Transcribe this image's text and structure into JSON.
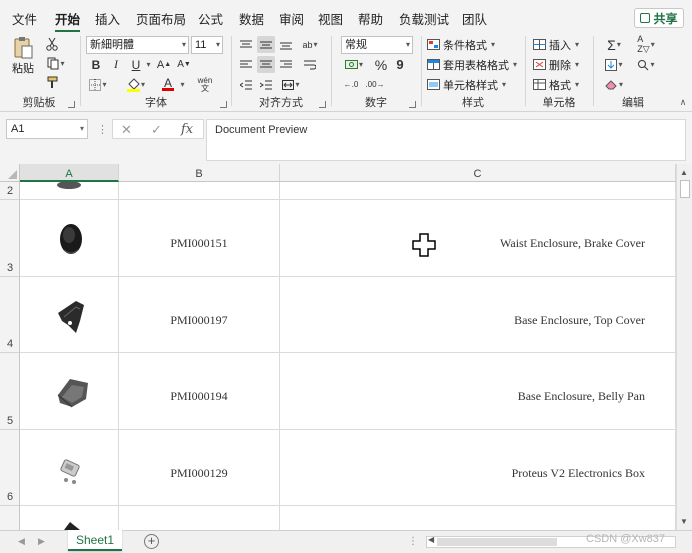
{
  "menu": {
    "tabs": [
      "文件",
      "开始",
      "插入",
      "页面布局",
      "公式",
      "数据",
      "审阅",
      "视图",
      "帮助",
      "负载测试",
      "团队"
    ],
    "active_tab": "开始",
    "share_label": "共享"
  },
  "ribbon": {
    "clipboard": {
      "label": "剪贴板",
      "paste": "粘贴"
    },
    "font": {
      "label": "字体",
      "font_name": "新細明體",
      "font_size": "11",
      "bold": "B",
      "italic": "I",
      "underline": "U",
      "font_color": "A",
      "phonetic": "wén"
    },
    "alignment": {
      "label": "对齐方式"
    },
    "number": {
      "label": "数字",
      "format": "常规",
      "percent": "%",
      "comma": "9"
    },
    "styles": {
      "label": "样式",
      "conditional": "条件格式",
      "table": "套用表格格式",
      "cell_styles": "单元格样式"
    },
    "cells": {
      "label": "单元格",
      "insert": "插入",
      "delete": "删除",
      "format": "格式"
    },
    "editing": {
      "label": "编辑",
      "sum": "Σ"
    }
  },
  "formula_bar": {
    "name_box": "A1",
    "content": "Document Preview",
    "fx": "fx"
  },
  "grid": {
    "columns": [
      "A",
      "B",
      "C"
    ],
    "selected_column": "A",
    "rows": [
      {
        "num": "2",
        "code": "",
        "desc": ""
      },
      {
        "num": "3",
        "code": "PMI000151",
        "desc": "Waist Enclosure, Brake Cover"
      },
      {
        "num": "4",
        "code": "PMI000197",
        "desc": "Base Enclosure, Top Cover"
      },
      {
        "num": "5",
        "code": "PMI000194",
        "desc": "Base Enclosure, Belly Pan"
      },
      {
        "num": "6",
        "code": "PMI000129",
        "desc": "Proteus V2 Electronics Box"
      }
    ]
  },
  "sheets": {
    "tabs": [
      "Sheet1"
    ],
    "add": "+"
  },
  "watermark": "CSDN @Xw837",
  "colors": {
    "accent": "#217346",
    "ribbon_bg": "#f3f3f3",
    "grid_line": "#dadada"
  }
}
